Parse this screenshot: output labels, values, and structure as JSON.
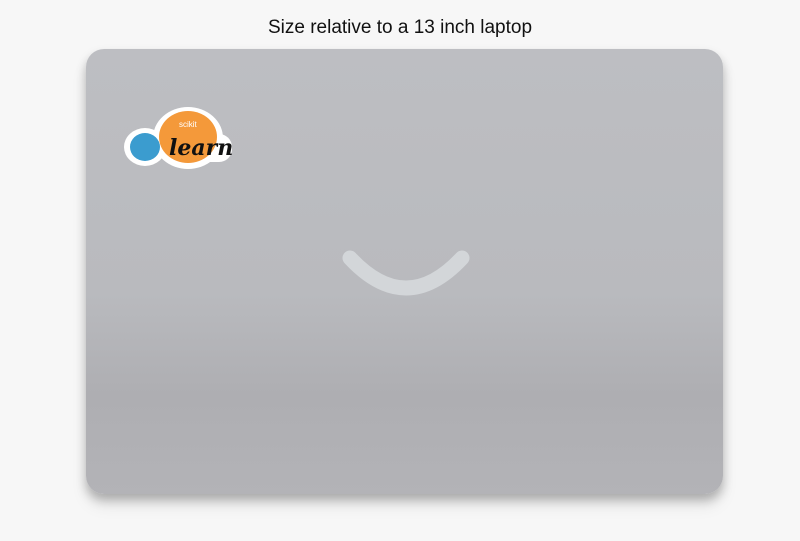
{
  "caption": "Size relative to a 13 inch laptop",
  "sticker": {
    "small_text": "scikit",
    "large_text": "learn",
    "colors": {
      "blue": "#3b9ccf",
      "orange": "#f4993a",
      "outline": "#ffffff"
    }
  },
  "laptop": {
    "lid_color": "#babbbf",
    "logo_color": "#d3d6d9"
  }
}
